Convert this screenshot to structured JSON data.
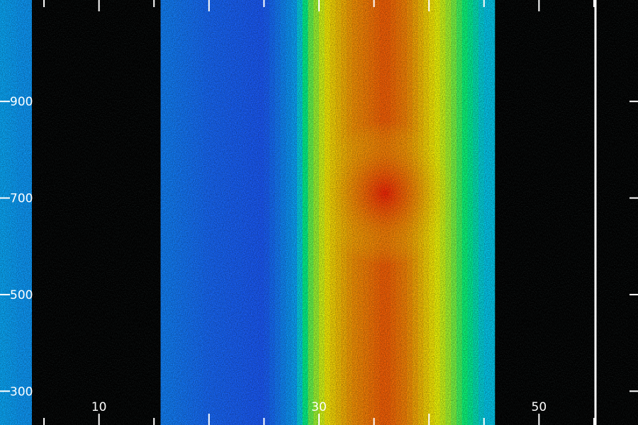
{
  "chart_data": {
    "type": "heatmap",
    "title": "",
    "xlabel": "",
    "ylabel": "",
    "xlim": [
      1,
      59
    ],
    "ylim": [
      230,
      1110
    ],
    "x_ticks": [
      10,
      30,
      50
    ],
    "y_ticks": [
      300,
      500,
      700,
      900
    ],
    "x_tick_labels": [
      "10",
      "30",
      "50"
    ],
    "y_tick_labels": [
      "300",
      "500",
      "700",
      "900"
    ],
    "colormap": [
      "#000000",
      "#1e3cff",
      "#00c8ff",
      "#00ff80",
      "#ffff00",
      "#ff8000",
      "#ff0000"
    ],
    "data_gaps": [
      {
        "x_start": 3.9,
        "x_end": 15.6
      },
      {
        "x_start": 46,
        "x_end": 59
      }
    ],
    "intensity_profile": {
      "x": [
        1,
        3,
        16,
        20,
        25,
        28,
        29,
        31,
        33,
        36,
        38,
        40,
        42,
        44,
        45
      ],
      "level": [
        0.3,
        0.28,
        0.25,
        0.22,
        0.2,
        0.3,
        0.55,
        0.7,
        0.8,
        0.88,
        0.82,
        0.7,
        0.6,
        0.45,
        0.35
      ]
    },
    "hotspot": {
      "x": 36,
      "y": [
        620,
        800
      ],
      "level": 0.95
    }
  }
}
